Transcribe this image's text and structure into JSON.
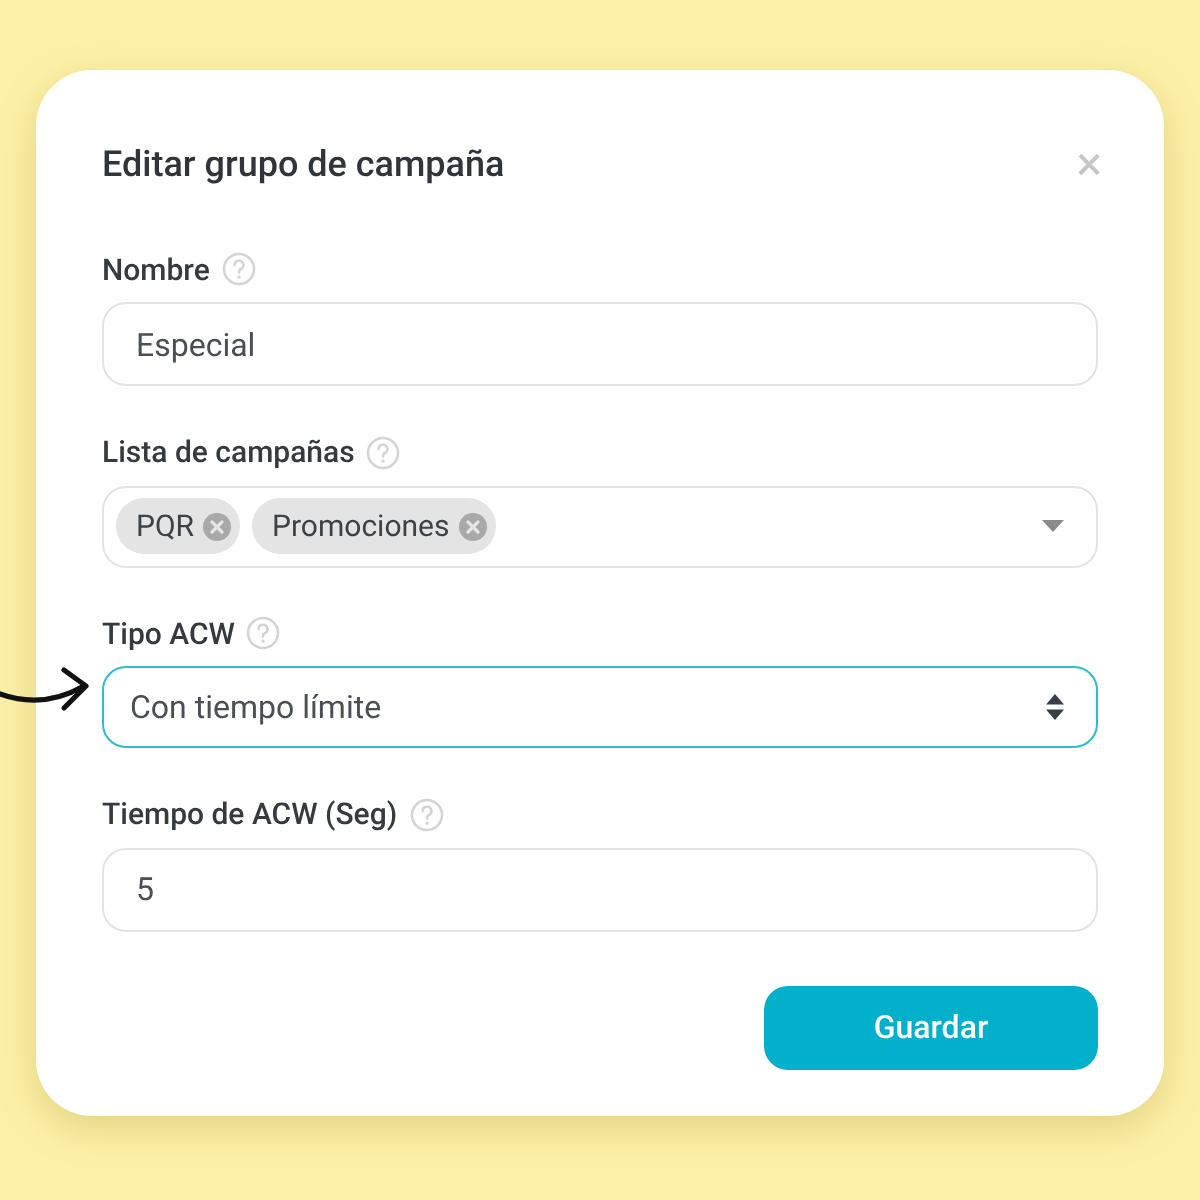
{
  "dialog": {
    "title": "Editar grupo de campaña",
    "close": "×"
  },
  "fields": [
    {
      "kind": "text",
      "label": "Nombre",
      "value": "Especial",
      "focused": false
    },
    {
      "kind": "tags",
      "label": "Lista de campañas",
      "tags": [
        "PQR",
        "Promociones"
      ],
      "focused": false
    },
    {
      "kind": "select",
      "label": "Tipo ACW",
      "value": "Con tiempo límite",
      "focused": true
    },
    {
      "kind": "text",
      "label": "Tiempo de ACW (Seg)",
      "value": "5",
      "focused": false
    }
  ],
  "buttons": [
    "Guardar"
  ]
}
